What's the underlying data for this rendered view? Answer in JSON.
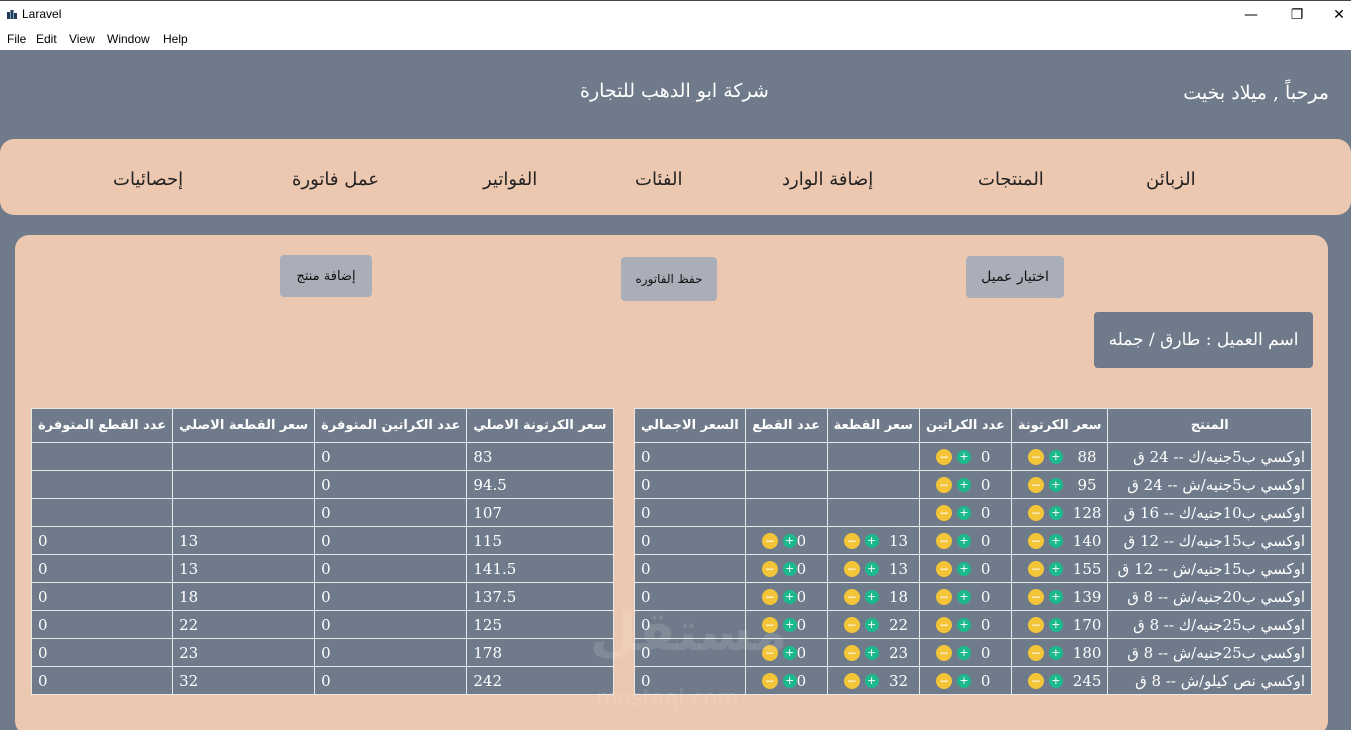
{
  "window": {
    "title": "Laravel",
    "minimize": "—",
    "maximize": "❐",
    "close": "✕"
  },
  "menu": [
    "File",
    "Edit",
    "View",
    "Window",
    "Help"
  ],
  "header": {
    "welcome": "مرحباً , ميلاد بخيت",
    "company": "شركة ابو الدهب للتجارة"
  },
  "nav": [
    "الزبائن",
    "المنتجات",
    "إضافة الوارد",
    "الفئات",
    "الفواتير",
    "عمل فاتورة",
    "إحصائيات"
  ],
  "actions": {
    "add_product": "إضافة منتج",
    "save_invoice": "حفظ الفاتوره",
    "choose_client": "اختيار عميل",
    "client_name": "اسم العميل : طارق / جمله"
  },
  "invoice_table": {
    "headers": [
      "المنتج",
      "سعر الكرتونة",
      "عدد الكراتين",
      "سعر القطعة",
      "عدد القطع",
      "السعر الاجمالي"
    ],
    "rows": [
      {
        "product": "اوكسي ب5جنيه/ك -- 24 ق",
        "carton_price": "88",
        "cartons": "0",
        "piece_price": "",
        "pieces": "",
        "total": "0"
      },
      {
        "product": "اوكسي ب5جنيه/ش -- 24 ق",
        "carton_price": "95",
        "cartons": "0",
        "piece_price": "",
        "pieces": "",
        "total": "0"
      },
      {
        "product": "اوكسي ب10جنيه/ك -- 16 ق",
        "carton_price": "128",
        "cartons": "0",
        "piece_price": "",
        "pieces": "",
        "total": "0"
      },
      {
        "product": "اوكسي ب15جنيه/ك -- 12 ق",
        "carton_price": "140",
        "cartons": "0",
        "piece_price": "13",
        "pieces": "0",
        "total": "0"
      },
      {
        "product": "اوكسي ب15جنيه/ش -- 12 ق",
        "carton_price": "155",
        "cartons": "0",
        "piece_price": "13",
        "pieces": "0",
        "total": "0"
      },
      {
        "product": "اوكسي ب20جنيه/ش -- 8 ق",
        "carton_price": "139",
        "cartons": "0",
        "piece_price": "18",
        "pieces": "0",
        "total": "0"
      },
      {
        "product": "اوكسي ب25جنيه/ك -- 8 ق",
        "carton_price": "170",
        "cartons": "0",
        "piece_price": "22",
        "pieces": "0",
        "total": "0"
      },
      {
        "product": "اوكسي ب25جنيه/ش -- 8 ق",
        "carton_price": "180",
        "cartons": "0",
        "piece_price": "23",
        "pieces": "0",
        "total": "0"
      },
      {
        "product": "اوكسي نص كيلو/ش -- 8 ق",
        "carton_price": "245",
        "cartons": "0",
        "piece_price": "32",
        "pieces": "0",
        "total": "0"
      }
    ]
  },
  "stock_table": {
    "headers": [
      "سعر الكرتونة الاصلي",
      "عدد الكراتين المتوفرة",
      "سعر القطعة الاصلي",
      "عدد القطع المتوفرة"
    ],
    "rows": [
      {
        "orig_carton": "83",
        "cartons_avail": "0",
        "orig_piece": "",
        "pieces_avail": ""
      },
      {
        "orig_carton": "94.5",
        "cartons_avail": "0",
        "orig_piece": "",
        "pieces_avail": ""
      },
      {
        "orig_carton": "107",
        "cartons_avail": "0",
        "orig_piece": "",
        "pieces_avail": ""
      },
      {
        "orig_carton": "115",
        "cartons_avail": "0",
        "orig_piece": "13",
        "pieces_avail": "0"
      },
      {
        "orig_carton": "141.5",
        "cartons_avail": "0",
        "orig_piece": "13",
        "pieces_avail": "0"
      },
      {
        "orig_carton": "137.5",
        "cartons_avail": "0",
        "orig_piece": "18",
        "pieces_avail": "0"
      },
      {
        "orig_carton": "125",
        "cartons_avail": "0",
        "orig_piece": "22",
        "pieces_avail": "0"
      },
      {
        "orig_carton": "178",
        "cartons_avail": "0",
        "orig_piece": "23",
        "pieces_avail": "0"
      },
      {
        "orig_carton": "242",
        "cartons_avail": "0",
        "orig_piece": "32",
        "pieces_avail": "0"
      }
    ]
  },
  "controls": {
    "plus": "+",
    "minus": "−"
  },
  "watermark": {
    "ar": "مستقل",
    "en": "mostaql.com"
  },
  "colors": {
    "background": "#6f7b8a",
    "panel": "#edc8b0",
    "button": "#a9aeb8",
    "plus": "#1bb98c",
    "minus": "#f3c437"
  },
  "icons": [
    "app-icon",
    "minimize-icon",
    "maximize-icon",
    "close-icon",
    "plus-icon",
    "minus-icon"
  ]
}
